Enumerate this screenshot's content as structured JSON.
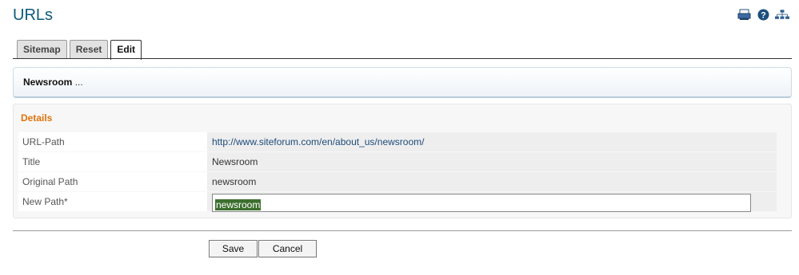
{
  "page": {
    "title": "URLs"
  },
  "icons": {
    "print": "print-icon",
    "help": "help-icon",
    "sitemap": "sitemap-icon"
  },
  "tabs": [
    {
      "label": "Sitemap",
      "active": false
    },
    {
      "label": "Reset",
      "active": false
    },
    {
      "label": "Edit",
      "active": true
    }
  ],
  "breadcrumb": {
    "label": "Newsroom",
    "suffix": " ..."
  },
  "details": {
    "title": "Details",
    "rows": [
      {
        "label": "URL-Path",
        "value": "http://www.siteforum.com/en/about_us/newsroom/"
      },
      {
        "label": "Title",
        "value": "Newsroom"
      },
      {
        "label": "Original Path",
        "value": "newsroom"
      },
      {
        "label": "New Path*",
        "value": "newsroom"
      }
    ]
  },
  "buttons": {
    "save": "Save",
    "cancel": "Cancel"
  },
  "colors": {
    "title": "#0d5a7a",
    "section_title": "#e0730b",
    "selection": "#3c6f2e"
  }
}
